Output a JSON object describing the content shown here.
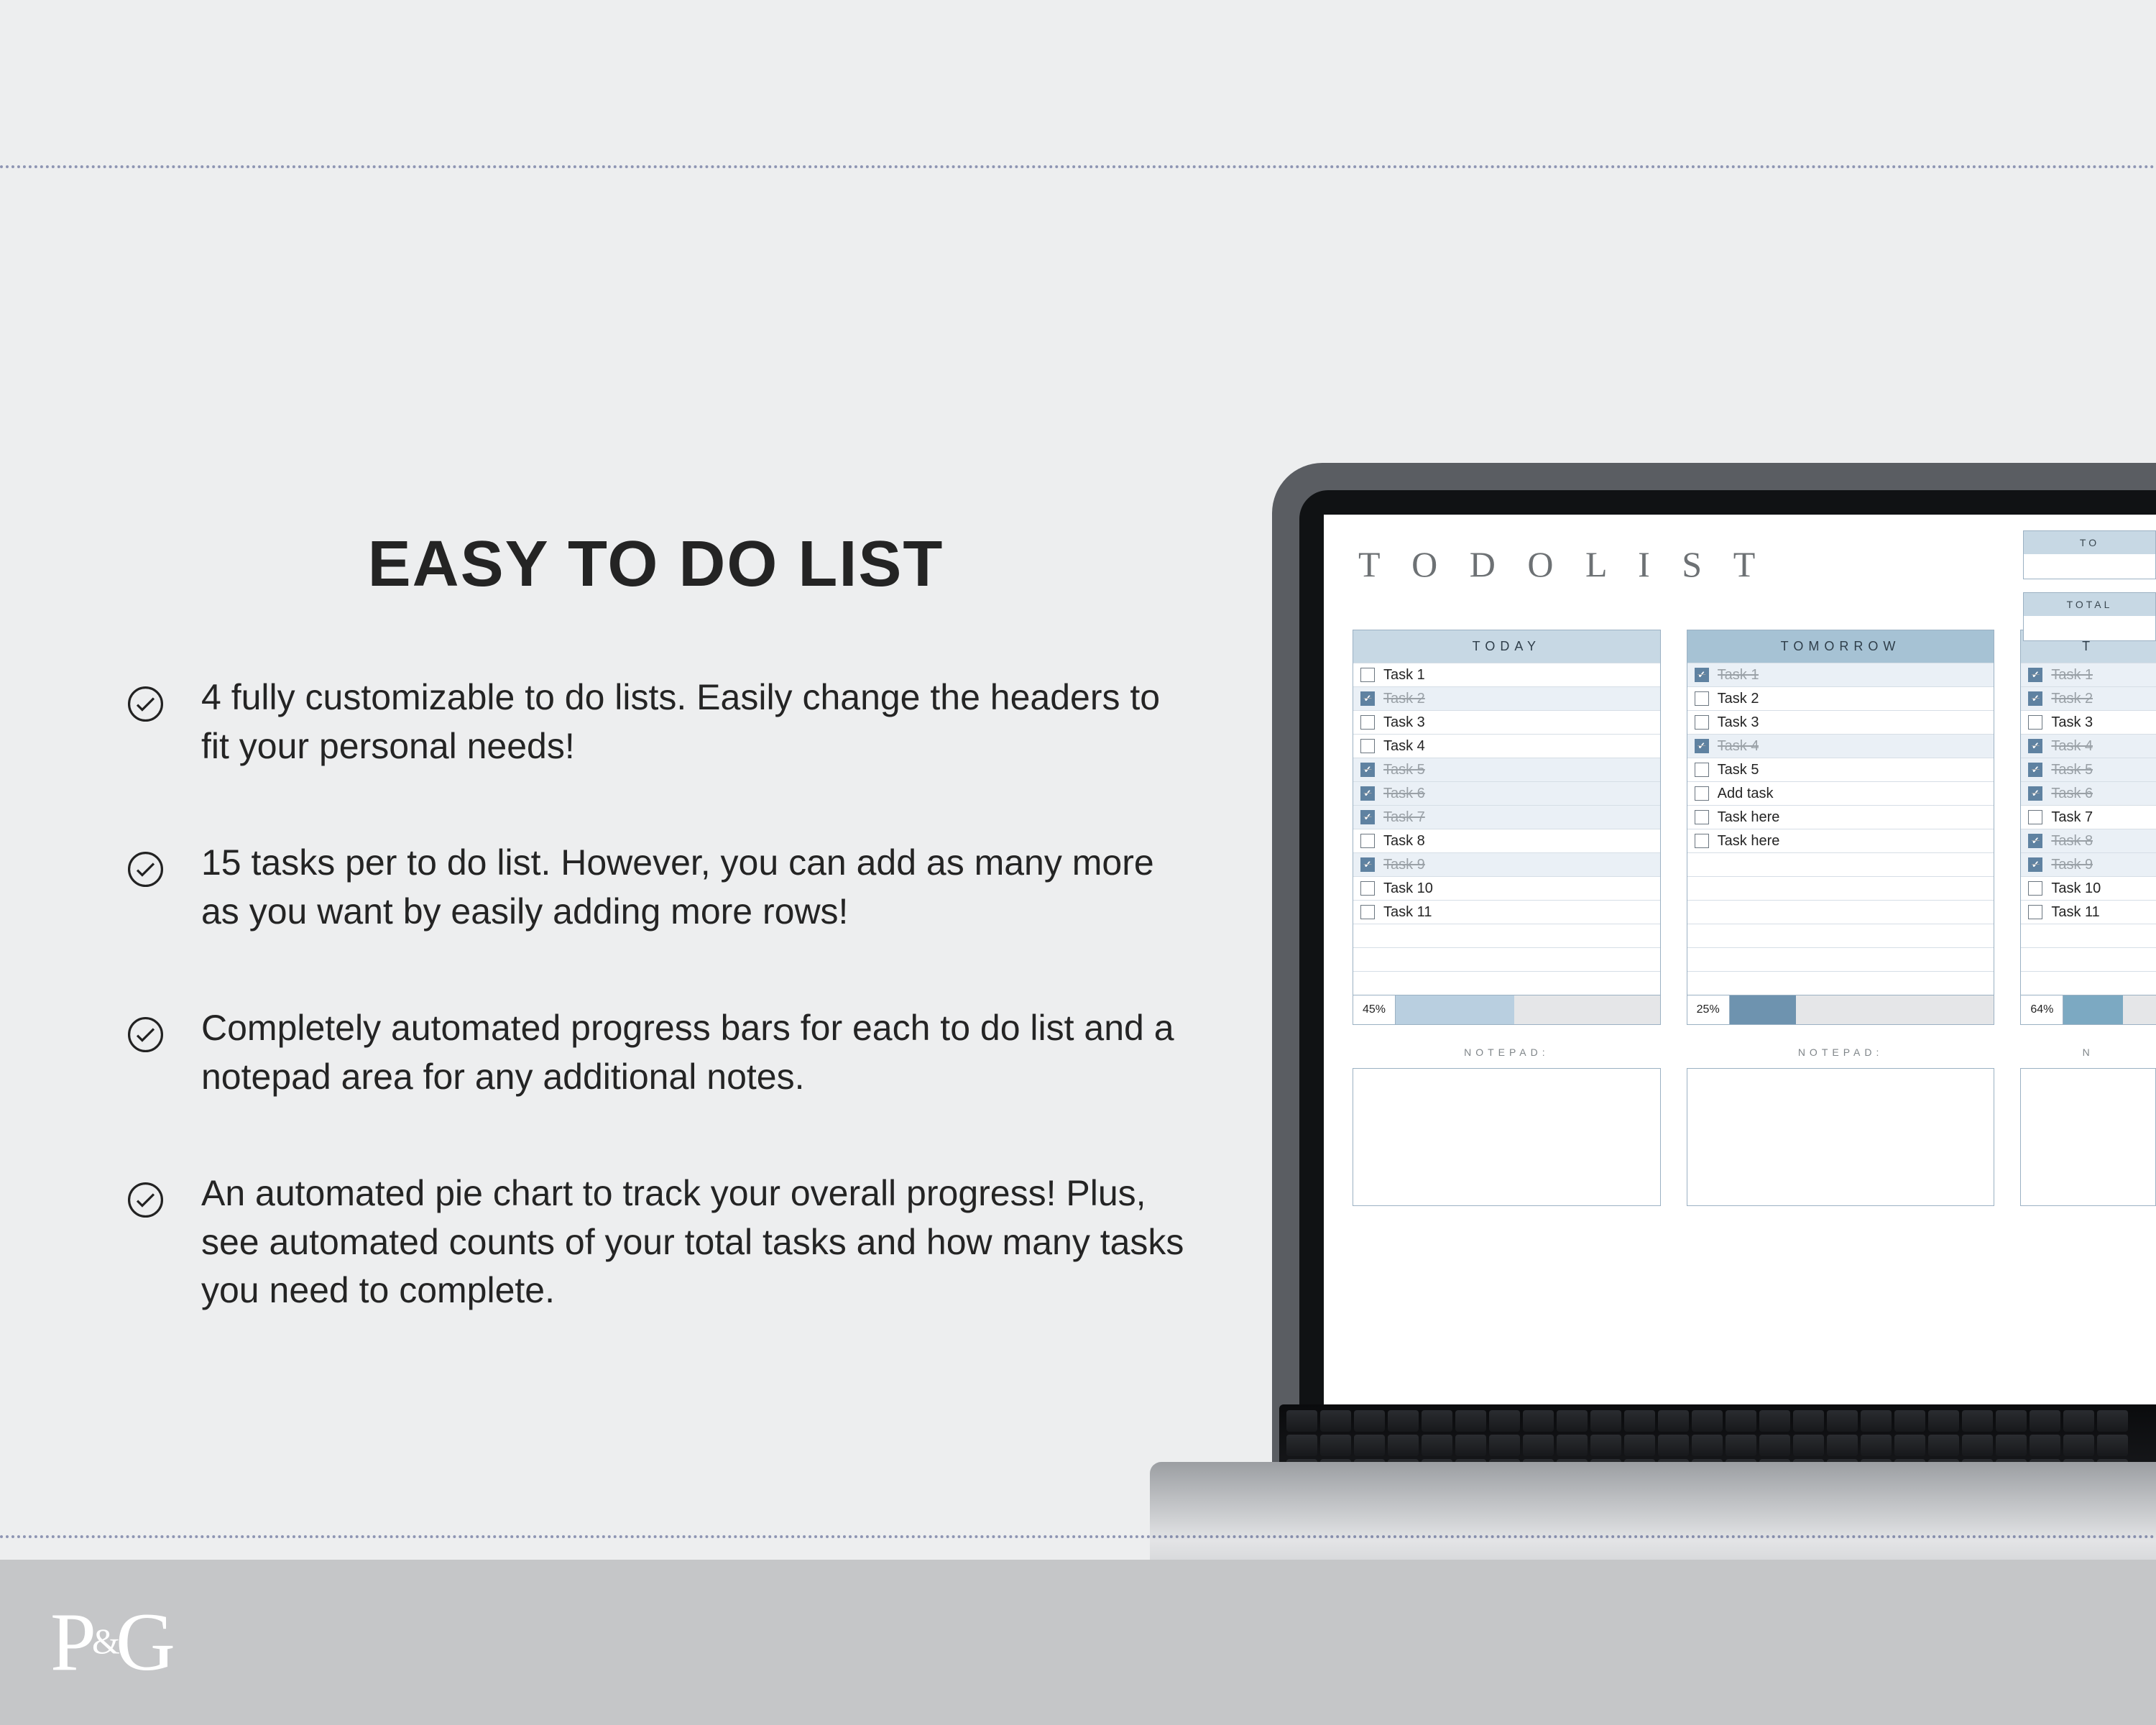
{
  "headline": "EASY TO DO LIST",
  "features": [
    "4 fully customizable to do lists. Easily change the headers to fit your personal needs!",
    "15 tasks per to do list. However, you can add as many more as you want by easily adding more rows!",
    "Completely automated progress bars for each to do list and a notepad area for any additional notes.",
    "An automated pie chart to track your overall progress! Plus, see automated counts of your total tasks and how many tasks you need to complete."
  ],
  "sheet": {
    "title": "T O  D O  L I S T",
    "top_tiles": [
      {
        "label": "TO"
      },
      {
        "label": "TOTAL"
      }
    ],
    "notepad_label": "NOTEPAD:",
    "lists": [
      {
        "header": "TODAY",
        "progress_pct": "45%",
        "progress_val": 45,
        "fill": "#B9CFE0",
        "rows": [
          {
            "label": "Task 1",
            "done": false,
            "checked": false
          },
          {
            "label": "Task 2",
            "done": true,
            "checked": true
          },
          {
            "label": "Task 3",
            "done": false,
            "checked": false
          },
          {
            "label": "Task 4",
            "done": false,
            "checked": false
          },
          {
            "label": "Task 5",
            "done": true,
            "checked": true
          },
          {
            "label": "Task 6",
            "done": true,
            "checked": true
          },
          {
            "label": "Task 7",
            "done": true,
            "checked": true
          },
          {
            "label": "Task 8",
            "done": false,
            "checked": false
          },
          {
            "label": "Task 9",
            "done": true,
            "checked": true
          },
          {
            "label": "Task 10",
            "done": false,
            "checked": false
          },
          {
            "label": "Task 11",
            "done": false,
            "checked": false
          }
        ]
      },
      {
        "header": "TOMORROW",
        "progress_pct": "25%",
        "progress_val": 25,
        "fill": "#6E93AF",
        "rows": [
          {
            "label": "Task 1",
            "done": true,
            "checked": true
          },
          {
            "label": "Task 2",
            "done": false,
            "checked": false
          },
          {
            "label": "Task 3",
            "done": false,
            "checked": false
          },
          {
            "label": "Task 4",
            "done": true,
            "checked": true
          },
          {
            "label": "Task 5",
            "done": false,
            "checked": false
          },
          {
            "label": "Add task",
            "done": false,
            "checked": false
          },
          {
            "label": "Task here",
            "done": false,
            "checked": false
          },
          {
            "label": "Task here",
            "done": false,
            "checked": false
          }
        ]
      },
      {
        "header": "T",
        "progress_pct": "64%",
        "progress_val": 64,
        "fill": "#7CA9C2",
        "rows": [
          {
            "label": "Task 1",
            "done": true,
            "checked": true
          },
          {
            "label": "Task 2",
            "done": true,
            "checked": true
          },
          {
            "label": "Task 3",
            "done": false,
            "checked": false
          },
          {
            "label": "Task 4",
            "done": true,
            "checked": true
          },
          {
            "label": "Task 5",
            "done": true,
            "checked": true
          },
          {
            "label": "Task 6",
            "done": true,
            "checked": true
          },
          {
            "label": "Task 7",
            "done": false,
            "checked": false
          },
          {
            "label": "Task 8",
            "done": true,
            "checked": true
          },
          {
            "label": "Task 9",
            "done": true,
            "checked": true
          },
          {
            "label": "Task 10",
            "done": false,
            "checked": false
          },
          {
            "label": "Task 11",
            "done": false,
            "checked": false
          }
        ]
      }
    ]
  },
  "logo": {
    "p": "P",
    "amp": "&",
    "g": "G"
  }
}
